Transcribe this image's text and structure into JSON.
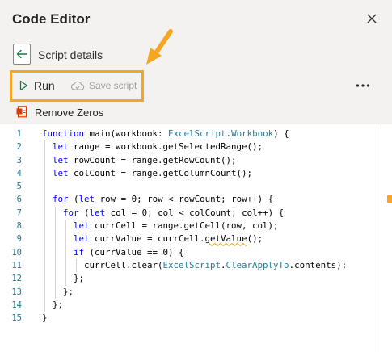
{
  "header": {
    "title": "Code Editor",
    "back_label": "Script details",
    "run_label": "Run",
    "save_label": "Save script",
    "script_name": "Remove Zeros"
  },
  "icons": [
    "close-icon",
    "back-arrow-icon",
    "play-icon",
    "cloud-save-icon",
    "more-icon",
    "script-file-icon",
    "callout-arrow-icon"
  ],
  "colors": {
    "highlight": "#f5a623",
    "keyword": "#0000ff",
    "type": "#267f99",
    "line_number": "#237893",
    "pane_background": "#f3f2f1"
  },
  "editor": {
    "line_numbers": [
      "1",
      "2",
      "3",
      "4",
      "5",
      "6",
      "7",
      "8",
      "9",
      "10",
      "11",
      "12",
      "13",
      "14",
      "15"
    ],
    "lines": [
      [
        {
          "t": "function",
          "c": "kw"
        },
        {
          "t": " main(workbook: "
        },
        {
          "t": "ExcelScript",
          "c": "ty"
        },
        {
          "t": "."
        },
        {
          "t": "Workbook",
          "c": "ty"
        },
        {
          "t": ") {"
        }
      ],
      [
        {
          "t": "  "
        },
        {
          "t": "let",
          "c": "kw"
        },
        {
          "t": " range = workbook.getSelectedRange();"
        }
      ],
      [
        {
          "t": "  "
        },
        {
          "t": "let",
          "c": "kw"
        },
        {
          "t": " rowCount = range.getRowCount();"
        }
      ],
      [
        {
          "t": "  "
        },
        {
          "t": "let",
          "c": "kw"
        },
        {
          "t": " colCount = range.getColumnCount();"
        }
      ],
      [
        {
          "t": ""
        }
      ],
      [
        {
          "t": "  "
        },
        {
          "t": "for",
          "c": "kw"
        },
        {
          "t": " ("
        },
        {
          "t": "let",
          "c": "kw"
        },
        {
          "t": " row = 0; row < rowCount; row++) {"
        }
      ],
      [
        {
          "t": "    "
        },
        {
          "t": "for",
          "c": "kw"
        },
        {
          "t": " ("
        },
        {
          "t": "let",
          "c": "kw"
        },
        {
          "t": " col = 0; col < colCount; col++) {"
        }
      ],
      [
        {
          "t": "      "
        },
        {
          "t": "let",
          "c": "kw"
        },
        {
          "t": " currCell = range.getCell(row, col);"
        }
      ],
      [
        {
          "t": "      "
        },
        {
          "t": "let",
          "c": "kw"
        },
        {
          "t": " currValue = currCell."
        },
        {
          "t": "getValue",
          "c": "squiggle"
        },
        {
          "t": "();"
        }
      ],
      [
        {
          "t": "      "
        },
        {
          "t": "if",
          "c": "kw"
        },
        {
          "t": " (currValue == 0) {"
        }
      ],
      [
        {
          "t": "        currCell.clear("
        },
        {
          "t": "ExcelScript",
          "c": "ty"
        },
        {
          "t": "."
        },
        {
          "t": "ClearApplyTo",
          "c": "ty"
        },
        {
          "t": ".contents);"
        }
      ],
      [
        {
          "t": "      };"
        }
      ],
      [
        {
          "t": "    };"
        }
      ],
      [
        {
          "t": "  };"
        }
      ],
      [
        {
          "t": "}"
        }
      ]
    ],
    "indent_levels": [
      0,
      1,
      1,
      1,
      1,
      1,
      2,
      3,
      3,
      3,
      4,
      3,
      2,
      1,
      0
    ]
  }
}
